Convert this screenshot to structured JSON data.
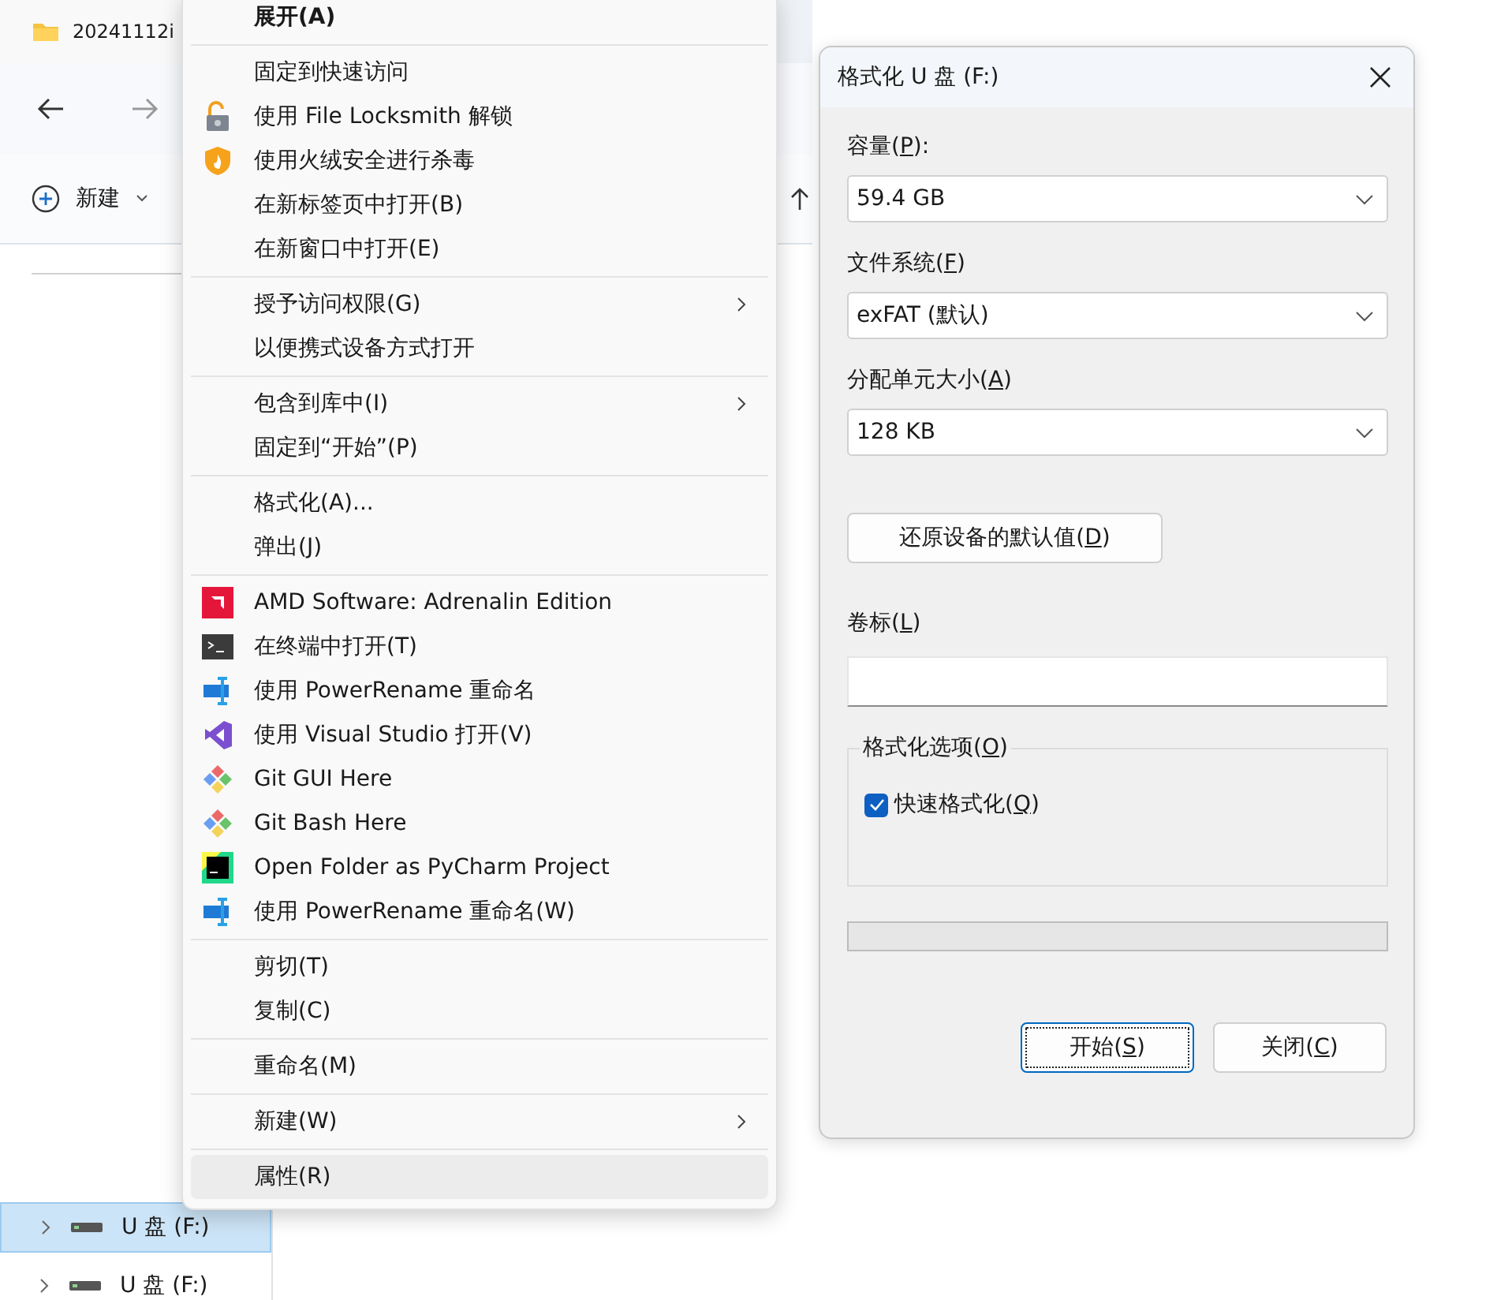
{
  "explorer": {
    "tab": {
      "title": "20241112i"
    },
    "toolbar": {
      "new_label": "新建"
    },
    "sidebar": {
      "items": [
        {
          "label": "U 盘 (F:)",
          "selected": true
        },
        {
          "label": "U 盘 (F:)",
          "selected": false
        }
      ]
    }
  },
  "context_menu": {
    "groups": [
      [
        {
          "label": "展开(A)",
          "kind": "plain",
          "default": true,
          "submenu": false,
          "highlighted": false
        }
      ],
      [
        {
          "label": "固定到快速访问",
          "kind": "plain",
          "default": false,
          "submenu": false,
          "highlighted": false
        },
        {
          "label": "使用 File Locksmith 解锁",
          "kind": "lock",
          "default": false,
          "submenu": false,
          "highlighted": false
        },
        {
          "label": "使用火绒安全进行杀毒",
          "kind": "shield",
          "default": false,
          "submenu": false,
          "highlighted": false
        },
        {
          "label": "在新标签页中打开(B)",
          "kind": "plain",
          "default": false,
          "submenu": false,
          "highlighted": false
        },
        {
          "label": "在新窗口中打开(E)",
          "kind": "plain",
          "default": false,
          "submenu": false,
          "highlighted": false
        }
      ],
      [
        {
          "label": "授予访问权限(G)",
          "kind": "plain",
          "default": false,
          "submenu": true,
          "highlighted": false
        },
        {
          "label": "以便携式设备方式打开",
          "kind": "plain",
          "default": false,
          "submenu": false,
          "highlighted": false
        }
      ],
      [
        {
          "label": "包含到库中(I)",
          "kind": "plain",
          "default": false,
          "submenu": true,
          "highlighted": false
        },
        {
          "label": "固定到“开始”(P)",
          "kind": "plain",
          "default": false,
          "submenu": false,
          "highlighted": false
        }
      ],
      [
        {
          "label": "格式化(A)...",
          "kind": "plain",
          "default": false,
          "submenu": false,
          "highlighted": false
        },
        {
          "label": "弹出(J)",
          "kind": "plain",
          "default": false,
          "submenu": false,
          "highlighted": false
        }
      ],
      [
        {
          "label": "AMD Software: Adrenalin Edition",
          "kind": "amd",
          "default": false,
          "submenu": false,
          "highlighted": false
        },
        {
          "label": "在终端中打开(T)",
          "kind": "terminal",
          "default": false,
          "submenu": false,
          "highlighted": false
        },
        {
          "label": "使用 PowerRename 重命名",
          "kind": "rename",
          "default": false,
          "submenu": false,
          "highlighted": false
        },
        {
          "label": "使用 Visual Studio 打开(V)",
          "kind": "vs",
          "default": false,
          "submenu": false,
          "highlighted": false
        },
        {
          "label": "Git GUI Here",
          "kind": "git",
          "default": false,
          "submenu": false,
          "highlighted": false
        },
        {
          "label": "Git Bash Here",
          "kind": "git",
          "default": false,
          "submenu": false,
          "highlighted": false
        },
        {
          "label": "Open Folder as PyCharm Project",
          "kind": "pycharm",
          "default": false,
          "submenu": false,
          "highlighted": false
        },
        {
          "label": "使用 PowerRename 重命名(W)",
          "kind": "rename",
          "default": false,
          "submenu": false,
          "highlighted": false
        }
      ],
      [
        {
          "label": "剪切(T)",
          "kind": "plain",
          "default": false,
          "submenu": false,
          "highlighted": false
        },
        {
          "label": "复制(C)",
          "kind": "plain",
          "default": false,
          "submenu": false,
          "highlighted": false
        }
      ],
      [
        {
          "label": "重命名(M)",
          "kind": "plain",
          "default": false,
          "submenu": false,
          "highlighted": false
        }
      ],
      [
        {
          "label": "新建(W)",
          "kind": "plain",
          "default": false,
          "submenu": true,
          "highlighted": false
        }
      ],
      [
        {
          "label": "属性(R)",
          "kind": "plain",
          "default": false,
          "submenu": false,
          "highlighted": true
        }
      ]
    ]
  },
  "dialog": {
    "title": "格式化 U 盘 (F:)",
    "combos": [
      {
        "label": [
          "容量(",
          "P",
          "):"
        ],
        "value": "59.4 GB"
      },
      {
        "label": [
          "文件系统(",
          "F",
          ")"
        ],
        "value": "exFAT (默认)"
      },
      {
        "label": [
          "分配单元大小(",
          "A",
          ")"
        ],
        "value": "128 KB"
      }
    ],
    "restore_button": [
      "还原设备的默认值(",
      "D",
      ")"
    ],
    "volume_label": {
      "label": [
        "卷标(",
        "L",
        ")"
      ]
    },
    "options": {
      "title": [
        "格式化选项(",
        "O",
        ")"
      ],
      "quick_format": {
        "label": [
          "快速格式化(",
          "Q",
          ")"
        ],
        "checked": true
      }
    },
    "progress": {
      "level": 0
    },
    "buttons": [
      {
        "label": [
          "开始(",
          "S",
          ")"
        ],
        "focused": true
      },
      {
        "label": [
          "关闭(",
          "C",
          ")"
        ],
        "focused": false
      }
    ]
  }
}
